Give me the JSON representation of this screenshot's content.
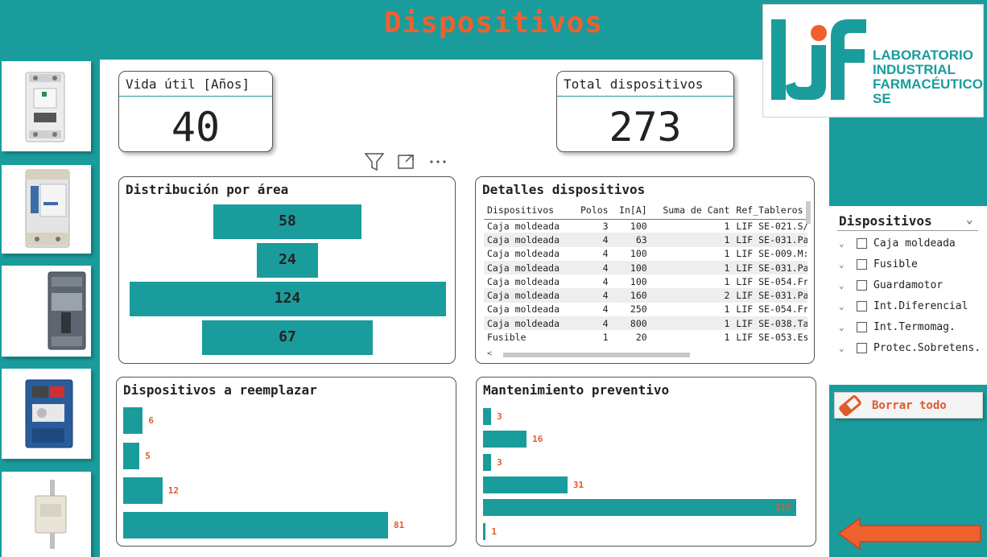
{
  "header": {
    "title": "Dispositivos"
  },
  "logo": {
    "mark": "LIF",
    "line1": "LABORATORIO",
    "line2": "INDUSTRIAL",
    "line3": "FARMACÉUTICO",
    "line4": "SE",
    "color_teal": "#1a9c9c",
    "color_orange": "#f0602e"
  },
  "thumbnails": [
    {
      "icon": "circuit-breaker-icon"
    },
    {
      "icon": "differential-switch-icon"
    },
    {
      "icon": "molded-case-breaker-icon"
    },
    {
      "icon": "motor-protector-icon"
    },
    {
      "icon": "fuse-icon"
    }
  ],
  "kpis": {
    "vida_util": {
      "title": "Vida útil [Años]",
      "value": "40"
    },
    "total": {
      "title": "Total dispositivos",
      "value": "273"
    }
  },
  "distribucion": {
    "title": "Distribución por área",
    "chart_data": {
      "type": "bar",
      "orientation": "horizontal-centered",
      "values": [
        58,
        24,
        124,
        67
      ],
      "labels": [
        "58",
        "24",
        "124",
        "67"
      ],
      "color": "#1a9c9c"
    }
  },
  "detalles": {
    "title": "Detalles dispositivos",
    "columns": [
      "Dispositivos",
      "Polos",
      "In[A]",
      "Suma de Cant",
      "Ref_Tableros"
    ],
    "rows": [
      [
        "Caja moldeada",
        "3",
        "100",
        "1",
        "LIF SE-021.S/"
      ],
      [
        "Caja moldeada",
        "4",
        "63",
        "1",
        "LIF SE-031.Pa"
      ],
      [
        "Caja moldeada",
        "4",
        "100",
        "1",
        "LIF SE-009.M:"
      ],
      [
        "Caja moldeada",
        "4",
        "100",
        "1",
        "LIF SE-031.Pa"
      ],
      [
        "Caja moldeada",
        "4",
        "100",
        "1",
        "LIF SE-054.Fr"
      ],
      [
        "Caja moldeada",
        "4",
        "160",
        "2",
        "LIF SE-031.Pa"
      ],
      [
        "Caja moldeada",
        "4",
        "250",
        "1",
        "LIF SE-054.Fr"
      ],
      [
        "Caja moldeada",
        "4",
        "800",
        "1",
        "LIF SE-038.Ta"
      ],
      [
        "Fusible",
        "1",
        "20",
        "1",
        "LIF SE-053.Es"
      ]
    ]
  },
  "reemplazar": {
    "title": "Dispositivos a reemplazar",
    "chart_data": {
      "type": "bar",
      "orientation": "horizontal",
      "values": [
        6,
        5,
        12,
        81
      ],
      "labels": [
        "6",
        "5",
        "12",
        "81"
      ],
      "color": "#1a9c9c",
      "label_color": "#e05a2a"
    }
  },
  "mantenimiento": {
    "title": "Mantenimiento preventivo",
    "chart_data": {
      "type": "bar",
      "orientation": "horizontal",
      "values": [
        3,
        16,
        3,
        31,
        115,
        1
      ],
      "labels": [
        "3",
        "16",
        "3",
        "31",
        "115",
        "1"
      ],
      "color": "#1a9c9c",
      "label_color": "#e05a2a"
    }
  },
  "slicer": {
    "title": "Dispositivos",
    "items": [
      "Caja moldeada",
      "Fusible",
      "Guardamotor",
      "Int.Diferencial",
      "Int.Termomag.",
      "Protec.Sobretens."
    ]
  },
  "clear_button": {
    "label": "Borrar todo"
  },
  "toolbar": {
    "icons": [
      "filter-icon",
      "focus-mode-icon",
      "more-options-icon"
    ]
  }
}
